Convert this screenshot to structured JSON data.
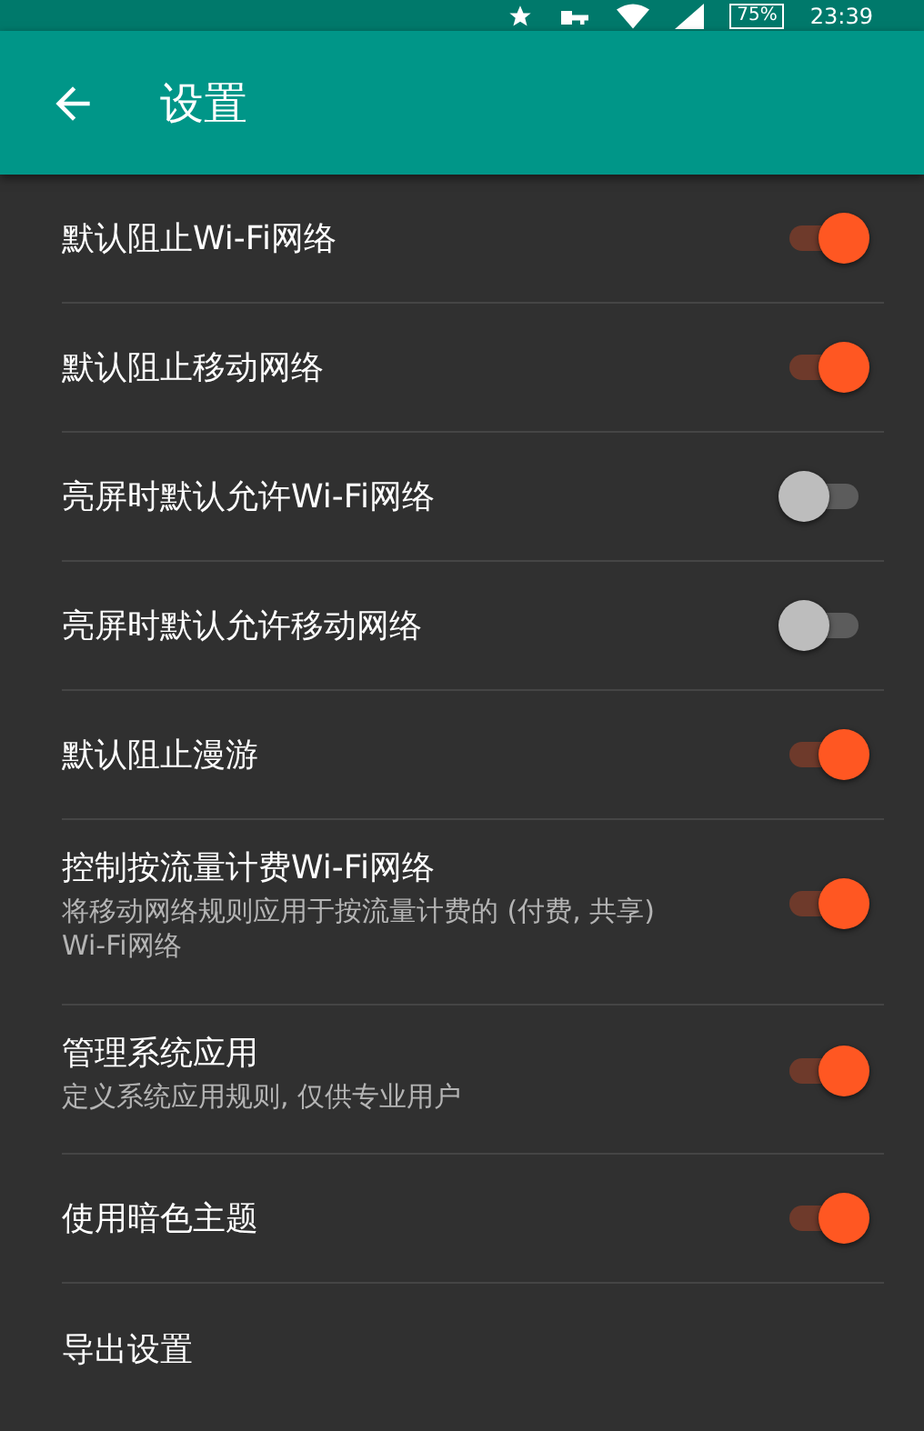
{
  "status_bar": {
    "battery": "75%",
    "time": "23:39"
  },
  "app_bar": {
    "title": "设置"
  },
  "settings": [
    {
      "kind": "toggle",
      "title": "默认阻止Wi-Fi网络",
      "on": true
    },
    {
      "kind": "toggle",
      "title": "默认阻止移动网络",
      "on": true
    },
    {
      "kind": "toggle",
      "title": "亮屏时默认允许Wi-Fi网络",
      "on": false
    },
    {
      "kind": "toggle",
      "title": "亮屏时默认允许移动网络",
      "on": false
    },
    {
      "kind": "toggle",
      "title": "默认阻止漫游",
      "on": true
    },
    {
      "kind": "toggle",
      "title": "控制按流量计费Wi-Fi网络",
      "summary": "将移动网络规则应用于按流量计费的 (付费, 共享) Wi-Fi网络",
      "on": true
    },
    {
      "kind": "toggle",
      "title": "管理系统应用",
      "summary": "定义系统应用规则, 仅供专业用户",
      "on": true
    },
    {
      "kind": "toggle",
      "title": "使用暗色主题",
      "on": true
    },
    {
      "kind": "action",
      "title": "导出设置"
    }
  ]
}
